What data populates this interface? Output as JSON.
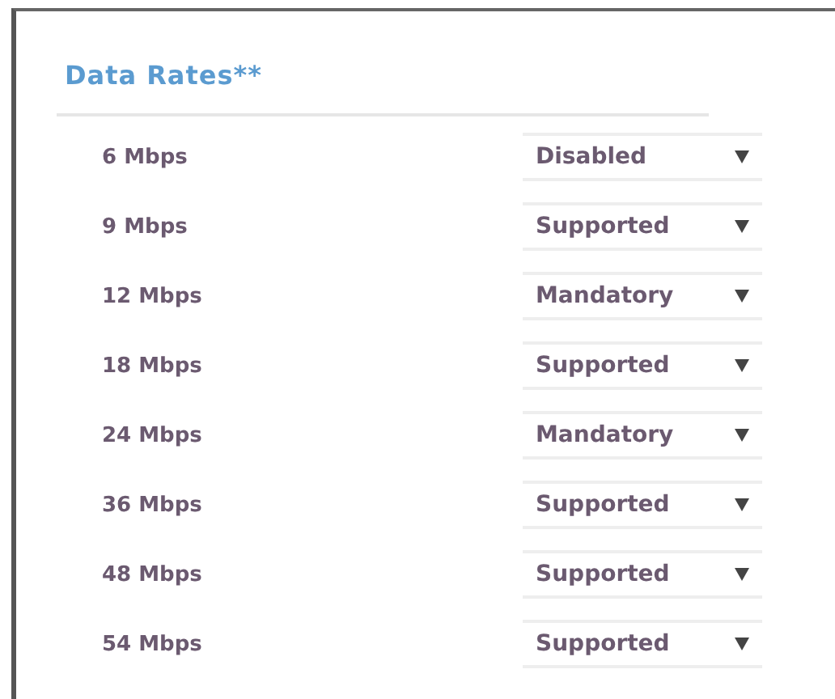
{
  "section": {
    "title": "Data Rates**"
  },
  "rates": [
    {
      "rate": "6 Mbps",
      "value": "Disabled"
    },
    {
      "rate": "9 Mbps",
      "value": "Supported"
    },
    {
      "rate": "12 Mbps",
      "value": "Mandatory"
    },
    {
      "rate": "18 Mbps",
      "value": "Supported"
    },
    {
      "rate": "24 Mbps",
      "value": "Mandatory"
    },
    {
      "rate": "36 Mbps",
      "value": "Supported"
    },
    {
      "rate": "48 Mbps",
      "value": "Supported"
    },
    {
      "rate": "54 Mbps",
      "value": "Supported"
    }
  ]
}
